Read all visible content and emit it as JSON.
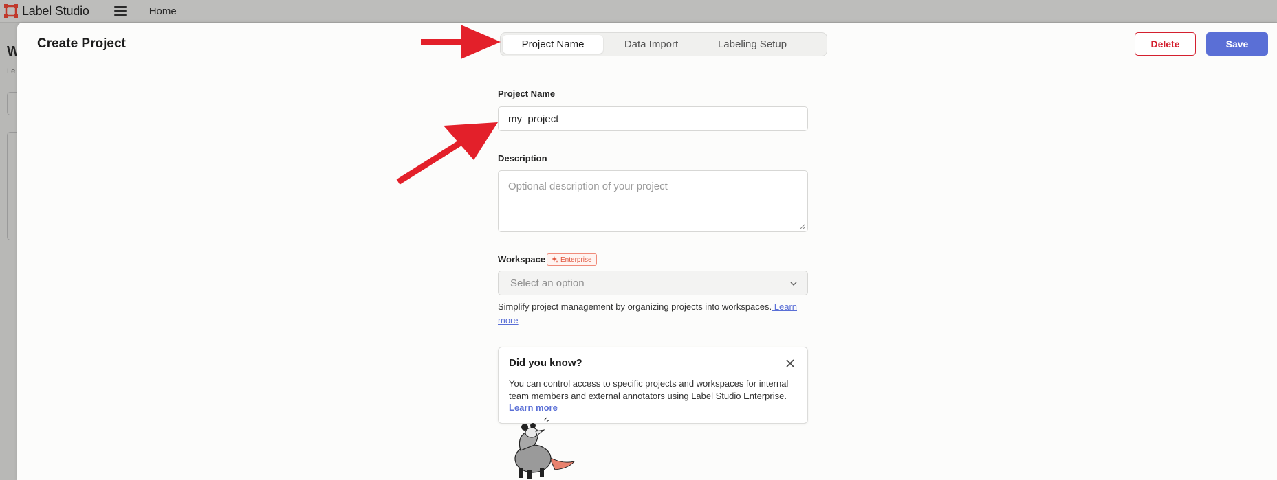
{
  "app": {
    "name": "Label Studio",
    "breadcrumb": "Home"
  },
  "background_page": {
    "heading_fragment": "W",
    "sub_fragment": "Le"
  },
  "modal": {
    "title": "Create Project",
    "tabs": [
      {
        "label": "Project Name",
        "active": true
      },
      {
        "label": "Data Import",
        "active": false
      },
      {
        "label": "Labeling Setup",
        "active": false
      }
    ],
    "delete_label": "Delete",
    "save_label": "Save"
  },
  "form": {
    "project_name": {
      "label": "Project Name",
      "value": "my_project"
    },
    "description": {
      "label": "Description",
      "placeholder": "Optional description of your project"
    },
    "workspace": {
      "label": "Workspace",
      "badge": "Enterprise",
      "select_placeholder": "Select an option",
      "helper_text": "Simplify project management by organizing projects into workspaces.",
      "helper_link": " Learn more"
    }
  },
  "tip": {
    "title": "Did you know?",
    "body": "You can control access to specific projects and workspaces for internal team members and external annotators using Label Studio Enterprise.",
    "link": "Learn more"
  },
  "colors": {
    "accent": "#5a6fd6",
    "danger": "#d4202f",
    "annotation_arrow": "#e3202a",
    "enterprise": "#e0553d"
  },
  "icons": [
    "label-studio-logo-icon",
    "hamburger-menu-icon",
    "chevron-down-icon",
    "close-icon",
    "sparkle-icon",
    "opossum-mascot-illustration"
  ]
}
